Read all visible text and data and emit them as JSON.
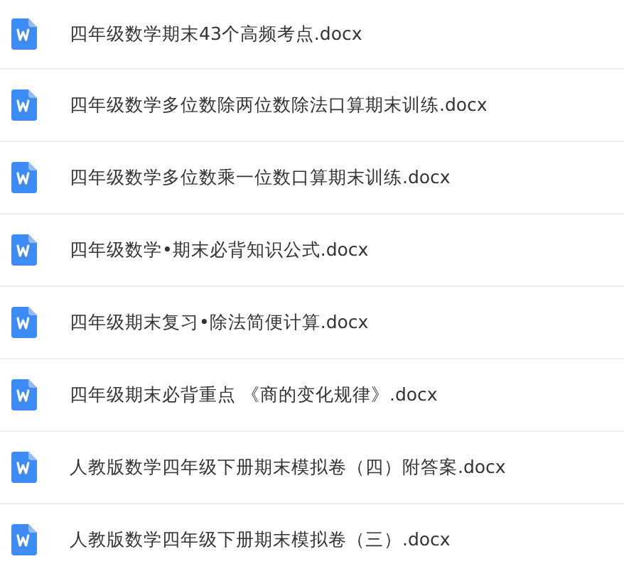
{
  "files": [
    {
      "name": "四年级数学期末43个高频考点.docx"
    },
    {
      "name": "四年级数学多位数除两位数除法口算期末训练.docx"
    },
    {
      "name": "四年级数学多位数乘一位数口算期末训练.docx"
    },
    {
      "name": "四年级数学•期末必背知识公式.docx"
    },
    {
      "name": "四年级期末复习•除法简便计算.docx"
    },
    {
      "name": "四年级期末必背重点 《商的变化规律》.docx"
    },
    {
      "name": "人教版数学四年级下册期末模拟卷（四）附答案.docx"
    },
    {
      "name": "人教版数学四年级下册期末模拟卷（三）.docx"
    }
  ]
}
